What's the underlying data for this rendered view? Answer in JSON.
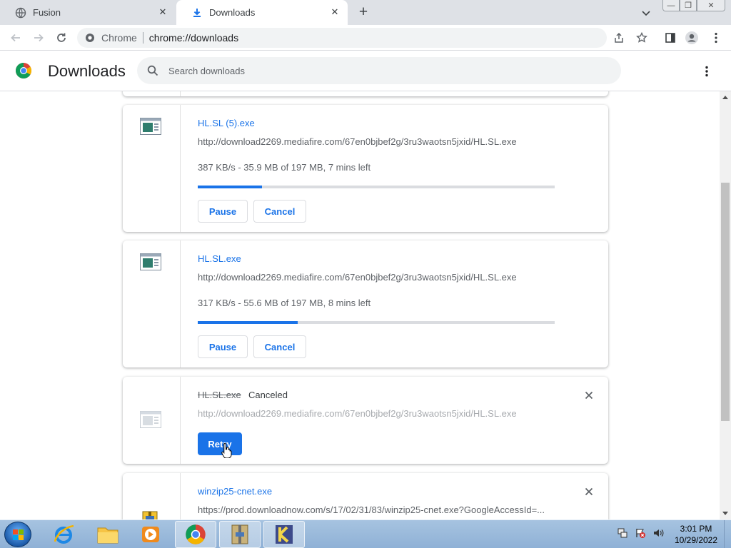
{
  "browser": {
    "tabs": [
      {
        "title": "Fusion",
        "icon": "globe-icon",
        "active": false
      },
      {
        "title": "Downloads",
        "icon": "download-icon",
        "active": true
      }
    ],
    "omnibox": {
      "site_label": "Chrome",
      "url": "chrome://downloads"
    }
  },
  "page": {
    "title": "Downloads",
    "search_placeholder": "Search downloads"
  },
  "downloads": [
    {
      "filename": "HL.SL (5).exe",
      "url": "http://download2269.mediafire.com/67en0bjbef2g/3ru3waotsn5jxid/HL.SL.exe",
      "progress_text": "387 KB/s - 35.9 MB of 197 MB, 7 mins left",
      "progress": 0.18,
      "pause_label": "Pause",
      "cancel_label": "Cancel"
    },
    {
      "filename": "HL.SL.exe",
      "url": "http://download2269.mediafire.com/67en0bjbef2g/3ru3waotsn5jxid/HL.SL.exe",
      "progress_text": "317 KB/s - 55.6 MB of 197 MB, 8 mins left",
      "progress": 0.28,
      "pause_label": "Pause",
      "cancel_label": "Cancel"
    },
    {
      "filename": "HL.SL.exe",
      "status": "Canceled",
      "url": "http://download2269.mediafire.com/67en0bjbef2g/3ru3waotsn5jxid/HL.SL.exe",
      "retry_label": "Retry"
    },
    {
      "filename": "winzip25-cnet.exe",
      "url": "https://prod.downloadnow.com/s/17/02/31/83/winzip25-cnet.exe?GoogleAccessId=..."
    }
  ],
  "taskbar": {
    "apps": [
      "internet-explorer",
      "file-explorer",
      "media-player",
      "chrome",
      "archive-tool",
      "k-app"
    ],
    "clock_time": "3:01 PM",
    "clock_date": "10/29/2022"
  },
  "colors": {
    "accent": "#1a73e8",
    "tabstrip": "#dee1e6",
    "progress_track": "#dadce0"
  }
}
